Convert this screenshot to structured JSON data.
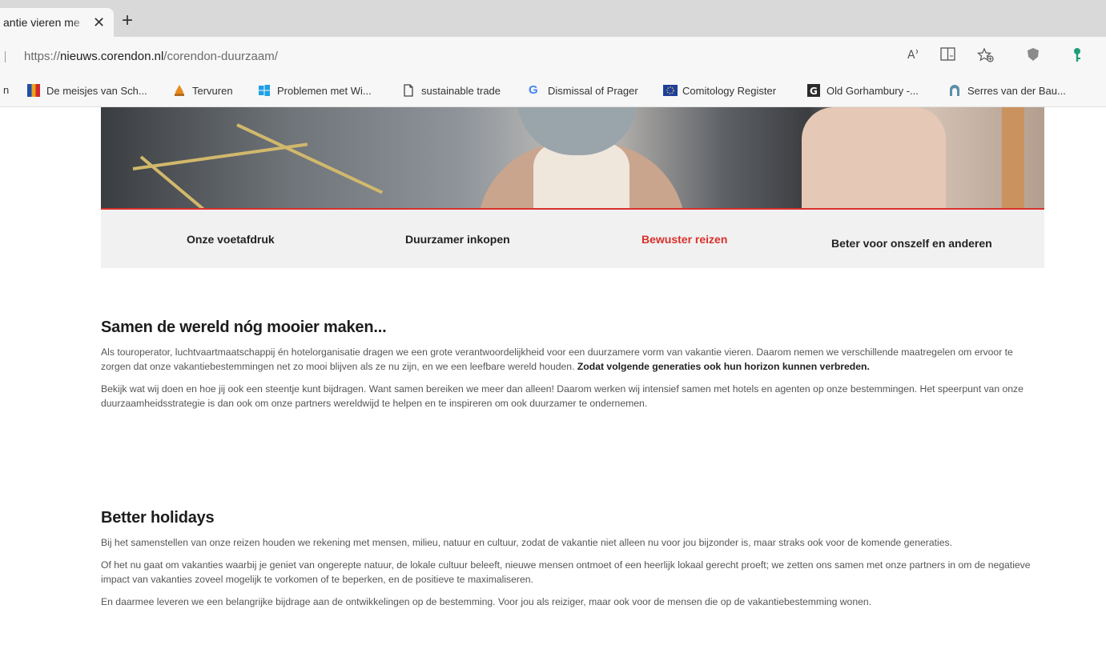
{
  "browser": {
    "tab_title": "antie vieren me",
    "url_prefix": "https://",
    "url_host": "nieuws.corendon.nl",
    "url_path": "/corendon-duurzaam/"
  },
  "bookmarks": [
    {
      "label": "n",
      "icon": "folder-icon"
    },
    {
      "label": "De meisjes van Sch...",
      "icon": "flag-icon"
    },
    {
      "label": "Tervuren",
      "icon": "drop-icon"
    },
    {
      "label": "Problemen met Wi...",
      "icon": "windows-icon"
    },
    {
      "label": "sustainable trade",
      "icon": "page-icon"
    },
    {
      "label": "Dismissal of Prager",
      "icon": "google-icon"
    },
    {
      "label": "Comitology Register",
      "icon": "eu-icon"
    },
    {
      "label": "Old Gorhambury -...",
      "icon": "g-box-icon"
    },
    {
      "label": "Serres van der Bau...",
      "icon": "arch-icon"
    }
  ],
  "nav": {
    "items": [
      {
        "label": "Onze voetafdruk"
      },
      {
        "label": "Duurzamer inkopen"
      },
      {
        "label": "Bewuster reizen"
      },
      {
        "label": "Beter voor onszelf en anderen"
      }
    ],
    "active_color": "#d9302b"
  },
  "section1": {
    "title": "Samen de wereld nóg mooier maken...",
    "p1_text": "Als touroperator, luchtvaartmaatschappij én hotelorganisatie dragen we een grote verantwoordelijkheid voor een duurzamere vorm van vakantie vieren. Daarom nemen we verschillende maatregelen om ervoor te zorgen dat onze vakantiebestemmingen net zo mooi blijven als ze nu zijn, en we een leefbare wereld houden. ",
    "p1_bold": "Zodat volgende generaties ook hun horizon kunnen verbreden.",
    "p2": "Bekijk wat wij doen en hoe jij ook een steentje kunt bijdragen. Want samen bereiken we meer dan alleen! Daarom werken wij intensief samen met hotels en agenten op onze bestemmingen. Het speerpunt van onze duurzaamheidsstrategie is dan ook om onze partners wereldwijd te helpen en te inspireren om ook duurzamer te ondernemen."
  },
  "section2": {
    "title": "Better holidays",
    "p1": "Bij het samenstellen van onze reizen houden we rekening met mensen, milieu, natuur en cultuur, zodat de vakantie niet alleen nu voor jou bijzonder is, maar straks ook voor de komende generaties.",
    "p2": "Of het nu gaat om vakanties waarbij je geniet van ongerepte natuur, de lokale cultuur beleeft, nieuwe mensen ontmoet of een heerlijk lokaal gerecht proeft; we zetten ons samen met onze partners in om de negatieve impact van vakanties zoveel mogelijk te vorkomen of te beperken, en de positieve te maximaliseren.",
    "p3": "En daarmee leveren we een belangrijke bijdrage aan de ontwikkelingen op de bestemming. Voor jou als reiziger, maar ook voor de mensen die op de vakantiebestemming wonen."
  }
}
